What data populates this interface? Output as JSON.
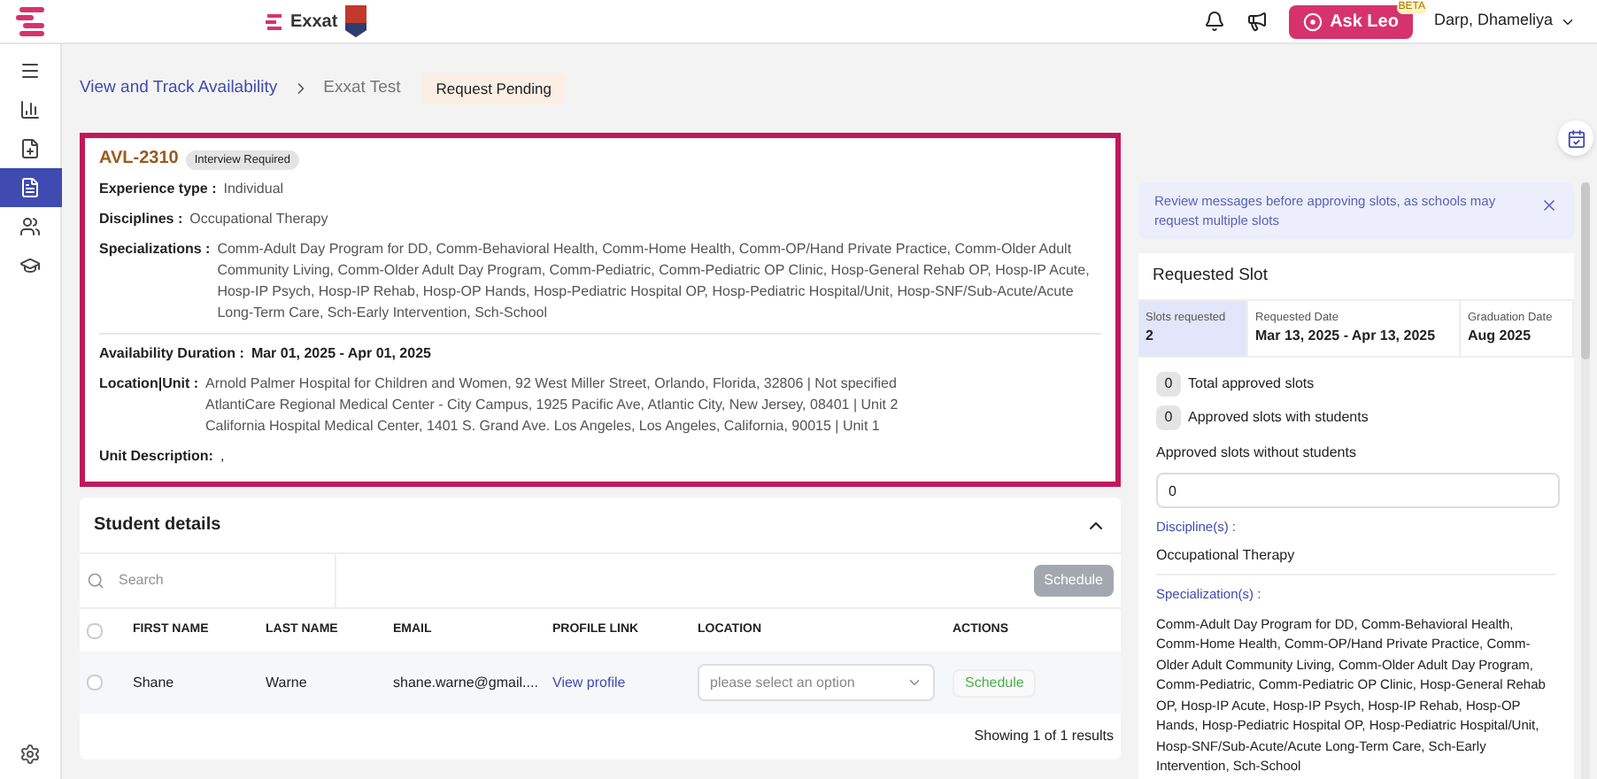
{
  "header": {
    "brand": "Exxat",
    "ask_button": "Ask Leo",
    "ask_badge": "BETA",
    "user": "Darp, Dhameliya"
  },
  "sidebar": {
    "items": [
      {
        "kind": "menu",
        "selected": false
      },
      {
        "kind": "chart",
        "selected": false
      },
      {
        "kind": "file-plus",
        "selected": false
      },
      {
        "kind": "file",
        "selected": true
      },
      {
        "kind": "users",
        "selected": false
      },
      {
        "kind": "cap",
        "selected": false
      }
    ]
  },
  "breadcrumb": {
    "link": "View and Track Availability",
    "current": "Exxat Test",
    "status": "Request Pending"
  },
  "availability": {
    "id": "AVL-2310",
    "tag": "Interview Required",
    "fields": [
      {
        "label": "Experience type :",
        "value": "Individual"
      },
      {
        "label": "Disciplines :",
        "value": "Occupational Therapy"
      },
      {
        "label": "Specializations :",
        "value": "Comm-Adult Day Program for DD, Comm-Behavioral Health, Comm-Home Health, Comm-OP/Hand Private Practice, Comm-Older Adult Community Living, Comm-Older Adult Day Program, Comm-Pediatric, Comm-Pediatric OP Clinic, Hosp-General Rehab OP, Hosp-IP Acute, Hosp-IP Psych, Hosp-IP Rehab, Hosp-OP Hands, Hosp-Pediatric Hospital OP, Hosp-Pediatric Hospital/Unit, Hosp-SNF/Sub-Acute/Acute Long-Term Care, Sch-Early Intervention, Sch-School"
      }
    ],
    "duration": {
      "label": "Availability Duration :",
      "value": "Mar 01, 2025 - Apr 01, 2025"
    },
    "location": {
      "label": "Location|Unit :",
      "lines": [
        "Arnold Palmer Hospital for Children and Women, 92 West Miller Street, Orlando, Florida, 32806 | Not specified",
        "AtlantiCare Regional Medical Center - City Campus, 1925 Pacific Ave, Atlantic City, New Jersey, 08401 | Unit 2",
        "California Hospital Medical Center, 1401 S. Grand Ave. Los Angeles, Los Angeles, California, 90015 | Unit 1"
      ]
    },
    "unit_description": {
      "label": "Unit Description:",
      "value": ","
    }
  },
  "students": {
    "title": "Student details",
    "select_all": {
      "checked": false
    },
    "search": {
      "placeholder": "Search"
    },
    "schedule_button": "Schedule",
    "columns": [
      "FIRST NAME",
      "LAST NAME",
      "EMAIL",
      "PROFILE LINK",
      "LOCATION",
      "ACTIONS"
    ],
    "rows": [
      {
        "checked": false,
        "first": "Shane",
        "last": "Warne",
        "email": "shane.warne@gmail....",
        "profile": "View profile",
        "location_placeholder": "please select an option",
        "action": "Schedule"
      }
    ],
    "footer": "Showing 1 of 1 results"
  },
  "notice": "Review messages before approving slots, as schools may request multiple slots",
  "slot": {
    "title": "Requested Slot",
    "stats": [
      {
        "label": "Slots requested",
        "value": "2",
        "selected": true
      },
      {
        "label": "Requested Date",
        "value": "Mar 13, 2025 - Apr 13, 2025",
        "selected": false
      },
      {
        "label": "Graduation Date",
        "value": "Aug 2025",
        "selected": false
      }
    ],
    "counts": [
      {
        "value": "0",
        "label": "Total approved slots"
      },
      {
        "value": "0",
        "label": "Approved slots with students"
      }
    ],
    "without_label": "Approved slots without students",
    "without_value": "0",
    "discipline_label": "Discipline(s) :",
    "discipline": "Occupational Therapy",
    "specialization_label": "Specialization(s) :",
    "specialization": "Comm-Adult Day Program for DD, Comm-Behavioral Health, Comm-Home Health, Comm-OP/Hand Private Practice, Comm-Older Adult Community Living, Comm-Older Adult Day Program, Comm-Pediatric, Comm-Pediatric OP Clinic, Hosp-General Rehab OP, Hosp-IP Acute, Hosp-IP Psych, Hosp-IP Rehab, Hosp-OP Hands, Hosp-Pediatric Hospital OP, Hosp-Pediatric Hospital/Unit, Hosp-SNF/Sub-Acute/Acute Long-Term Care, Sch-Early Intervention, Sch-School"
  }
}
